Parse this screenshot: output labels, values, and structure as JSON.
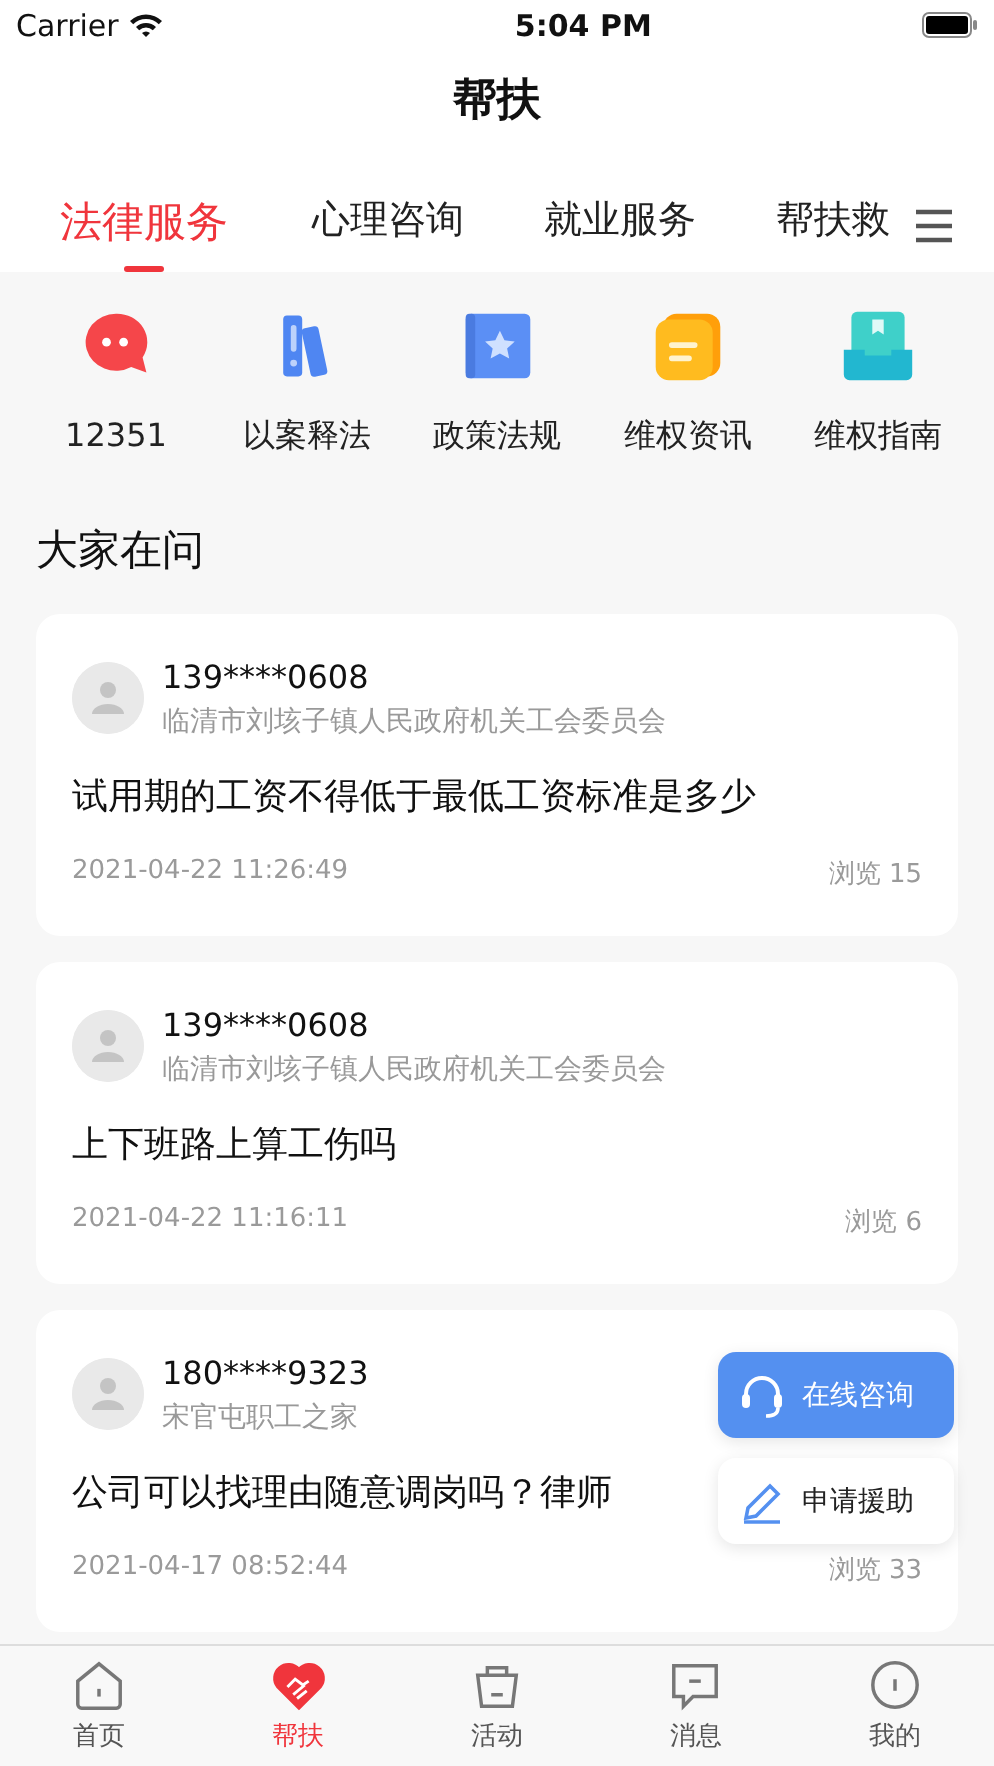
{
  "status_bar": {
    "carrier": "Carrier",
    "time": "5:04 PM"
  },
  "window": {
    "title": "帮扶"
  },
  "tabs": [
    {
      "label": "法律服务",
      "selected": true
    },
    {
      "label": "心理咨询",
      "selected": false
    },
    {
      "label": "就业服务",
      "selected": false
    },
    {
      "label": "帮扶救",
      "selected": false
    }
  ],
  "shortcuts": [
    {
      "label": "12351",
      "kind": "chat"
    },
    {
      "label": "以案释法",
      "kind": "books"
    },
    {
      "label": "政策法规",
      "kind": "star"
    },
    {
      "label": "维权资讯",
      "kind": "note"
    },
    {
      "label": "维权指南",
      "kind": "tray"
    }
  ],
  "section_title": "大家在问",
  "questions": [
    {
      "user": "139****0608",
      "org": "临清市刘垓子镇人民政府机关工会委员会",
      "question": "试用期的工资不得低于最低工资标准是多少",
      "date": "2021-04-22 11:26:49",
      "views": "浏览 15"
    },
    {
      "user": "139****0608",
      "org": "临清市刘垓子镇人民政府机关工会委员会",
      "question": "上下班路上算工伤吗",
      "date": "2021-04-22 11:16:11",
      "views": "浏览 6"
    },
    {
      "user": "180****9323",
      "org": "宋官屯职工之家",
      "question": "公司可以找理由随意调岗吗？律师",
      "date": "2021-04-17 08:52:44",
      "views": "浏览 33"
    }
  ],
  "floating_buttons": [
    {
      "label": "在线咨询",
      "kind": "primary"
    },
    {
      "label": "申请援助",
      "kind": "secondary"
    }
  ],
  "bottom_nav": [
    {
      "label": "首页",
      "kind": "home",
      "selected": false
    },
    {
      "label": "帮扶",
      "kind": "heart",
      "selected": true
    },
    {
      "label": "活动",
      "kind": "gift",
      "selected": false
    },
    {
      "label": "消息",
      "kind": "message",
      "selected": false
    },
    {
      "label": "我的",
      "kind": "profile",
      "selected": false
    }
  ]
}
